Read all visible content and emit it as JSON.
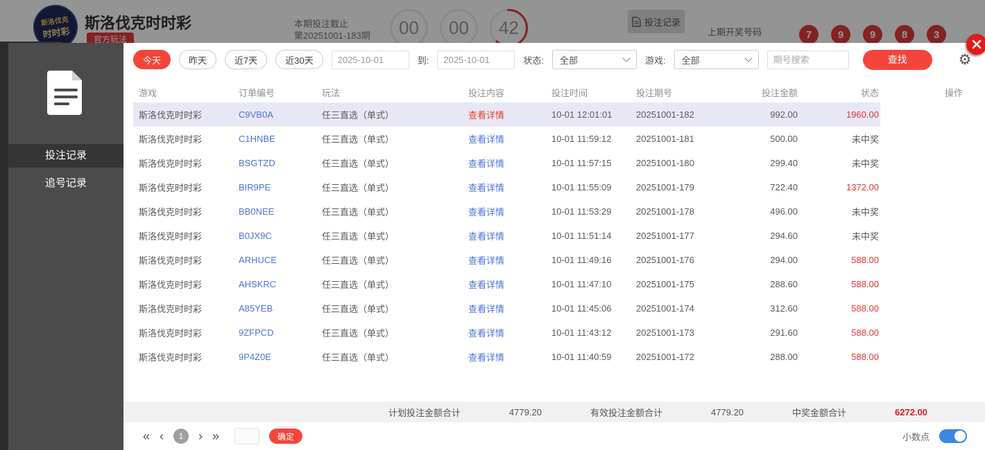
{
  "colors": {
    "accent_red": "#f4453b",
    "link_blue": "#4b74d9",
    "win_red": "#e53535",
    "row_highlight": "#e8e8f5",
    "toggle_on_blue": "#3d87e4",
    "ball_red": "#e23c3c"
  },
  "background": {
    "logo_line1": "斯洛伐克",
    "logo_line2": "时时彩",
    "title": "斯洛伐克时时彩",
    "tab_badge": "官方玩法",
    "deadline_label": "本期投注截止",
    "period_label": "第20251001-183期",
    "countdown": [
      "00",
      "00",
      "42"
    ],
    "bet_record_button": "投注记录",
    "last_draw_label": "上期开奖号码",
    "last_draw_numbers": [
      "7",
      "9",
      "9",
      "8",
      "3"
    ]
  },
  "modal": {
    "sidebar": {
      "items": [
        {
          "label": "投注记录",
          "active": true
        },
        {
          "label": "追号记录",
          "active": false
        }
      ]
    },
    "filters": {
      "quick_ranges": [
        "今天",
        "昨天",
        "近7天",
        "近30天"
      ],
      "date_from": "2025-10-01",
      "to_label": "到:",
      "date_to": "2025-10-01",
      "status_label": "状态:",
      "status_value": "全部",
      "game_label": "游戏:",
      "game_value": "全部",
      "search_placeholder": "期号搜索",
      "search_button": "查找"
    },
    "table": {
      "headers": [
        "游戏",
        "订单编号",
        "玩法",
        "投注内容",
        "投注时间",
        "投注期号",
        "投注金额",
        "状态",
        "操作"
      ],
      "detail_link": "查看详情",
      "rows": [
        {
          "game": "斯洛伐克时时彩",
          "order": "C9VB0A",
          "play": "任三直选（单式）",
          "time": "10-01 12:01:01",
          "period": "20251001-182",
          "amount": "992.00",
          "status": "1960.00",
          "win": true,
          "highlight": true
        },
        {
          "game": "斯洛伐克时时彩",
          "order": "C1HNBE",
          "play": "任三直选（单式）",
          "time": "10-01 11:59:12",
          "period": "20251001-181",
          "amount": "500.00",
          "status": "未中奖",
          "win": false,
          "highlight": false
        },
        {
          "game": "斯洛伐克时时彩",
          "order": "BSGTZD",
          "play": "任三直选（单式）",
          "time": "10-01 11:57:15",
          "period": "20251001-180",
          "amount": "299.40",
          "status": "未中奖",
          "win": false,
          "highlight": false
        },
        {
          "game": "斯洛伐克时时彩",
          "order": "BIR9PE",
          "play": "任三直选（单式）",
          "time": "10-01 11:55:09",
          "period": "20251001-179",
          "amount": "722.40",
          "status": "1372.00",
          "win": true,
          "highlight": false
        },
        {
          "game": "斯洛伐克时时彩",
          "order": "BB0NEE",
          "play": "任三直选（单式）",
          "time": "10-01 11:53:29",
          "period": "20251001-178",
          "amount": "496.00",
          "status": "未中奖",
          "win": false,
          "highlight": false
        },
        {
          "game": "斯洛伐克时时彩",
          "order": "B0JX9C",
          "play": "任三直选（单式）",
          "time": "10-01 11:51:14",
          "period": "20251001-177",
          "amount": "294.60",
          "status": "未中奖",
          "win": false,
          "highlight": false
        },
        {
          "game": "斯洛伐克时时彩",
          "order": "ARHUCE",
          "play": "任三直选（单式）",
          "time": "10-01 11:49:16",
          "period": "20251001-176",
          "amount": "294.00",
          "status": "588.00",
          "win": true,
          "highlight": false
        },
        {
          "game": "斯洛伐克时时彩",
          "order": "AHSKRC",
          "play": "任三直选（单式）",
          "time": "10-01 11:47:10",
          "period": "20251001-175",
          "amount": "288.60",
          "status": "588.00",
          "win": true,
          "highlight": false
        },
        {
          "game": "斯洛伐克时时彩",
          "order": "A85YEB",
          "play": "任三直选（单式）",
          "time": "10-01 11:45:06",
          "period": "20251001-174",
          "amount": "312.60",
          "status": "588.00",
          "win": true,
          "highlight": false
        },
        {
          "game": "斯洛伐克时时彩",
          "order": "9ZFPCD",
          "play": "任三直选（单式）",
          "time": "10-01 11:43:12",
          "period": "20251001-173",
          "amount": "291.60",
          "status": "588.00",
          "win": true,
          "highlight": false
        },
        {
          "game": "斯洛伐克时时彩",
          "order": "9P4Z0E",
          "play": "任三直选（单式）",
          "time": "10-01 11:40:59",
          "period": "20251001-172",
          "amount": "288.00",
          "status": "588.00",
          "win": true,
          "highlight": false
        }
      ]
    },
    "summary": {
      "plan_total_label": "计划投注金额合计",
      "plan_total": "4779.20",
      "valid_total_label": "有效投注金额合计",
      "valid_total": "4779.20",
      "win_total_label": "中奖金额合计",
      "win_total": "6272.00"
    },
    "pagination": {
      "first_icon": "«",
      "prev_icon": "‹",
      "current_page": "1",
      "next_icon": "›",
      "last_icon": "»",
      "confirm_button": "确定",
      "decimal_label": "小数点"
    }
  },
  "icons": {
    "gear": "⚙"
  }
}
